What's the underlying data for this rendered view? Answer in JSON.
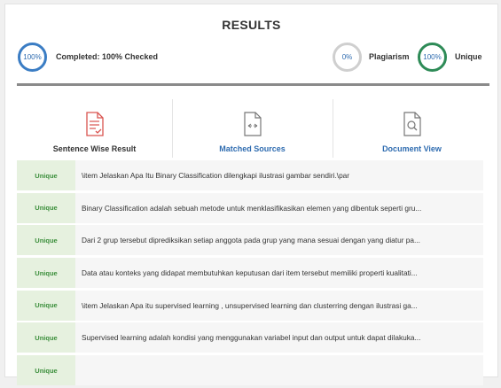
{
  "header": {
    "title": "RESULTS"
  },
  "stats": {
    "completed_ring": "100%",
    "completed_label": "Completed: 100% Checked",
    "plagiarism_ring": "0%",
    "plagiarism_label": "Plagiarism",
    "unique_ring": "100%",
    "unique_label": "Unique"
  },
  "tabs": [
    {
      "label": "Sentence Wise Result",
      "icon": "document-list-icon"
    },
    {
      "label": "Matched Sources",
      "icon": "document-compare-icon"
    },
    {
      "label": "Document View",
      "icon": "document-search-icon"
    }
  ],
  "rows": [
    {
      "badge": "Unique",
      "text": "\\item Jelaskan Apa Itu Binary Classification dilengkapi ilustrasi gambar sendiri.\\par"
    },
    {
      "badge": "Unique",
      "text": "Binary Classification adalah sebuah metode untuk menklasifikasikan elemen yang dibentuk seperti gru..."
    },
    {
      "badge": "Unique",
      "text": "Dari 2 grup tersebut diprediksikan setiap anggota pada grup yang mana sesuai dengan yang diatur pa..."
    },
    {
      "badge": "Unique",
      "text": "Data atau konteks yang didapat membutuhkan keputusan dari item tersebut memiliki properti kualitati..."
    },
    {
      "badge": "Unique",
      "text": "\\item Jelaskan Apa itu supervised learning , unsupervised learning dan clusterring dengan ilustrasi ga..."
    },
    {
      "badge": "Unique",
      "text": "Supervised learning adalah kondisi yang menggunakan variabel input dan output untuk dapat dilakuka..."
    },
    {
      "badge": "Unique",
      "text": ""
    }
  ],
  "colors": {
    "accent_blue": "#3b7dc4",
    "unique_green": "#2e8b57",
    "plagiarism_grey": "#cfcfcf",
    "badge_bg": "#e6f1df",
    "badge_text": "#3c8f3c",
    "icon_red": "#d9534f"
  }
}
